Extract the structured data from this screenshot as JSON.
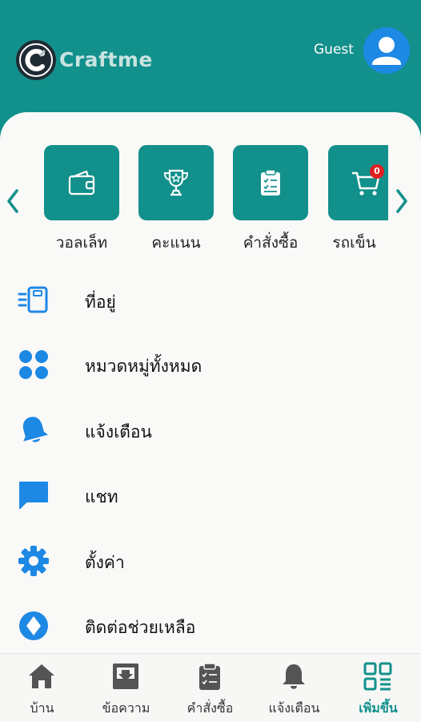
{
  "header": {
    "app_name": "Craftme",
    "user_label": "Guest",
    "brand_color": "#12908b"
  },
  "quick_actions": [
    {
      "label": "วอลเล็ท",
      "icon": "wallet-icon"
    },
    {
      "label": "คะแนน",
      "icon": "trophy-icon"
    },
    {
      "label": "คำสั่งซื้อ",
      "icon": "clipboard-icon"
    },
    {
      "label": "รถเข็น",
      "icon": "cart-icon",
      "badge": "0"
    }
  ],
  "menu": [
    {
      "label": "ที่อยู่",
      "icon": "address-icon"
    },
    {
      "label": "หมวดหมู่ทั้งหมด",
      "icon": "categories-icon"
    },
    {
      "label": "แจ้งเตือน",
      "icon": "bell-icon"
    },
    {
      "label": "แชท",
      "icon": "chat-icon"
    },
    {
      "label": "ตั้งค่า",
      "icon": "gear-icon"
    },
    {
      "label": "ติดต่อช่วยเหลือ",
      "icon": "help-icon"
    }
  ],
  "bottom_nav": [
    {
      "label": "บ้าน",
      "icon": "home-icon"
    },
    {
      "label": "ข้อความ",
      "icon": "inbox-icon"
    },
    {
      "label": "คำสั่งซื้อ",
      "icon": "clipboard-icon"
    },
    {
      "label": "แจ้งเตือน",
      "icon": "bell-icon"
    },
    {
      "label": "เพิ่มขึ้น",
      "icon": "qr-grid-icon",
      "active": true
    }
  ],
  "colors": {
    "accent": "#12908b",
    "menu_icon": "#1e88e5",
    "badge": "#e02020"
  }
}
